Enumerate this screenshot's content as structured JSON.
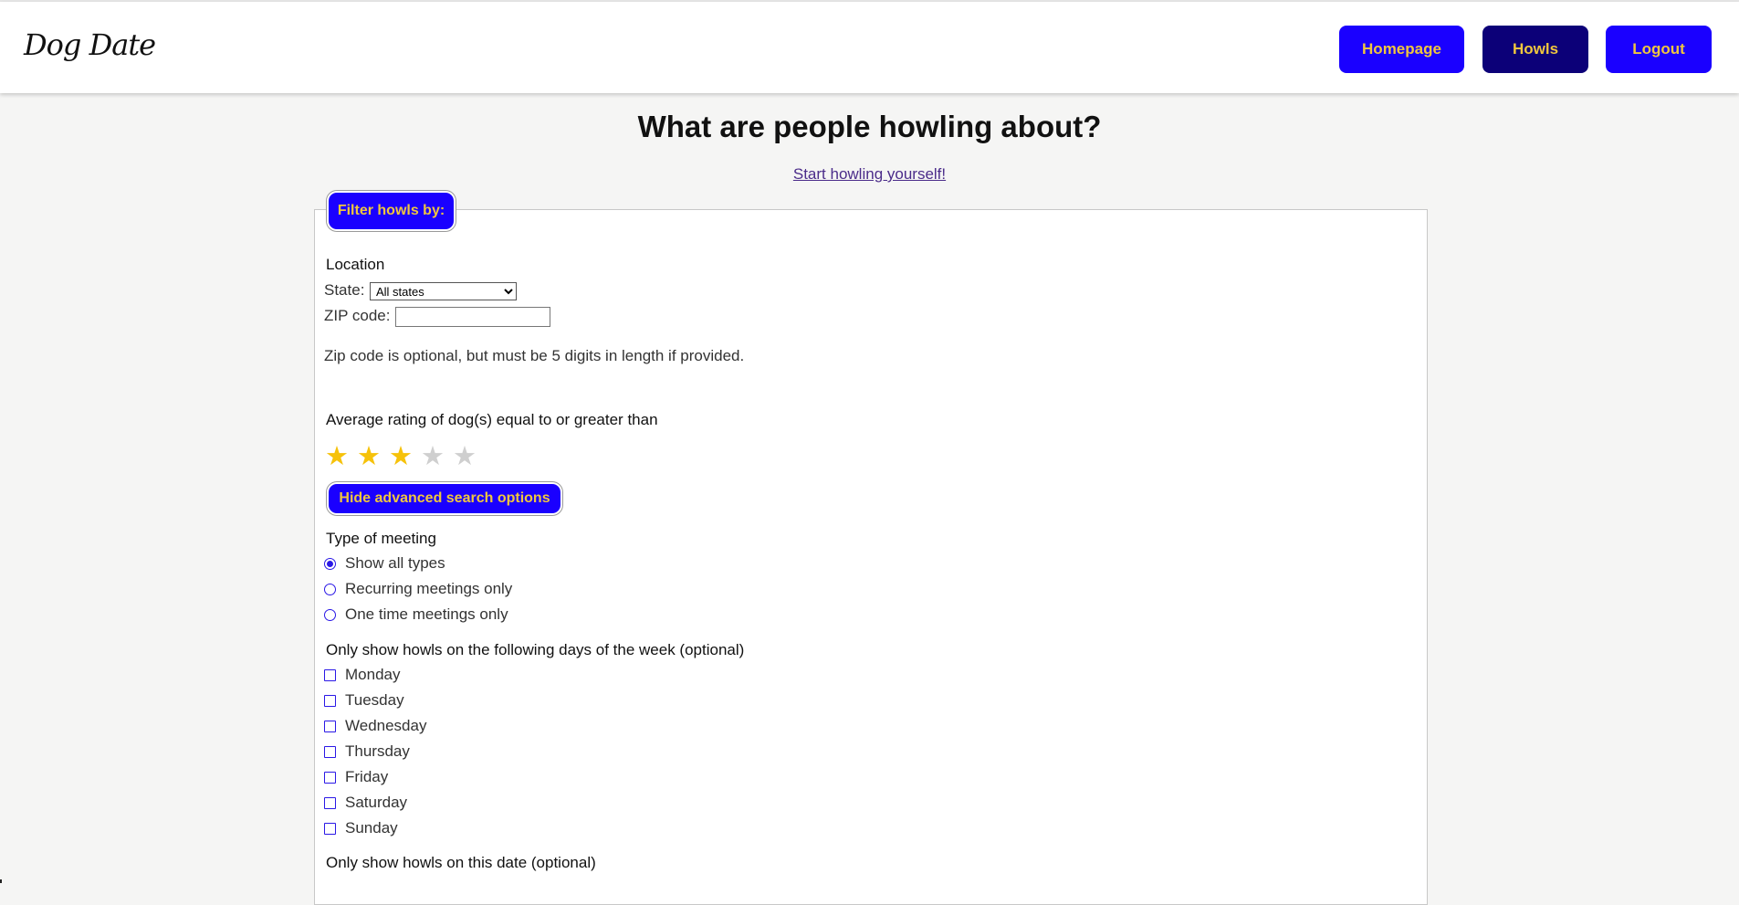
{
  "app": {
    "logo": "Dog Date"
  },
  "nav": {
    "homepage": "Homepage",
    "howls": "Howls",
    "logout": "Logout"
  },
  "page": {
    "title": "What are people howling about?",
    "start_link": "Start howling yourself!"
  },
  "filter": {
    "button": "Filter howls by:",
    "location_label": "Location",
    "state_label": "State:",
    "state_value": "All states",
    "zip_label": "ZIP code:",
    "zip_value": "",
    "zip_hint": "Zip code is optional, but must be 5 digits in length if provided.",
    "rating_label": "Average rating of dog(s) equal to or greater than",
    "rating_value": 3,
    "rating_max": 5,
    "advanced_button": "Hide advanced search options",
    "meeting_label": "Type of meeting",
    "meeting_options": [
      "Show all types",
      "Recurring meetings only",
      "One time meetings only"
    ],
    "meeting_selected": "Show all types",
    "days_label": "Only show howls on the following days of the week (optional)",
    "days": [
      "Monday",
      "Tuesday",
      "Wednesday",
      "Thursday",
      "Friday",
      "Saturday",
      "Sunday"
    ],
    "date_label": "Only show howls on this date (optional)"
  },
  "colors": {
    "brand_blue": "#1a00ff",
    "active_nav": "#0c0078",
    "button_text": "#f0c63e",
    "star_on": "#f6c20a",
    "star_off": "#cfcfcf"
  }
}
